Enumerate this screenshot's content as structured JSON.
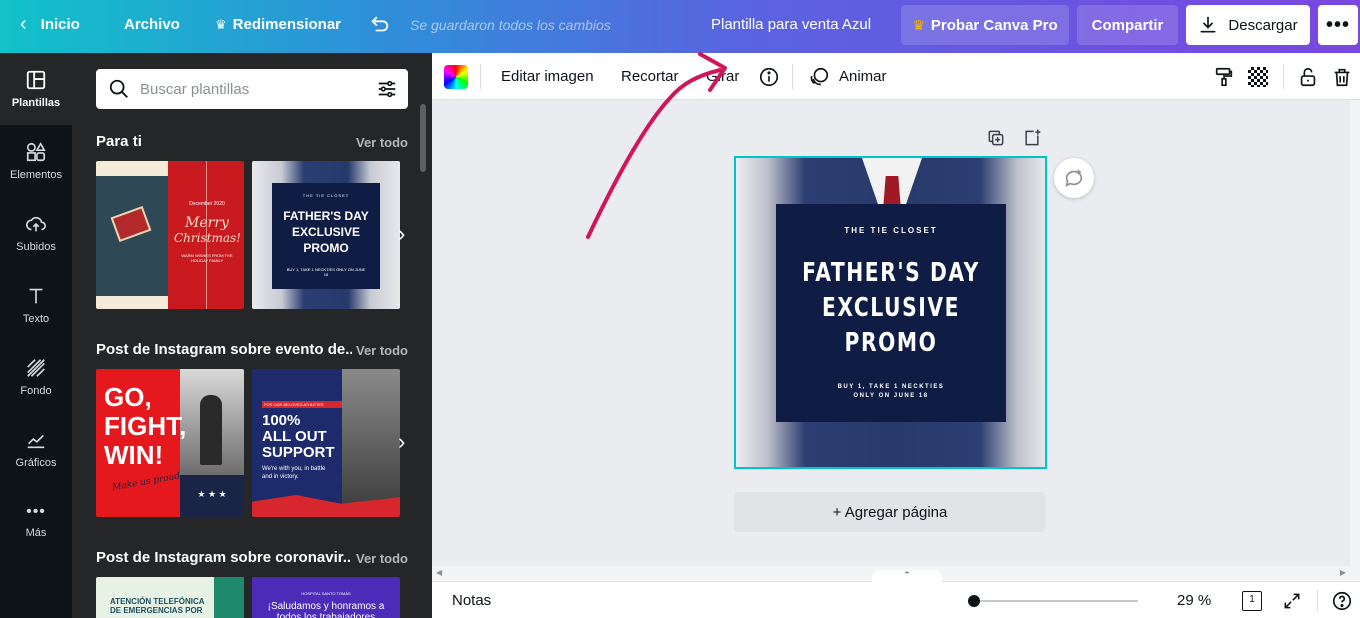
{
  "header": {
    "home_label": "Inicio",
    "file_label": "Archivo",
    "resize_label": "Redimensionar",
    "status_text": "Se guardaron todos los cambios",
    "design_title": "Plantilla para venta Azul",
    "try_pro_label": "Probar Canva Pro",
    "share_label": "Compartir",
    "download_label": "Descargar"
  },
  "rail": {
    "items": [
      {
        "label": "Plantillas"
      },
      {
        "label": "Elementos"
      },
      {
        "label": "Subidos"
      },
      {
        "label": "Texto"
      },
      {
        "label": "Fondo"
      },
      {
        "label": "Gráficos"
      },
      {
        "label": "Más"
      }
    ]
  },
  "panel": {
    "search_placeholder": "Buscar plantillas",
    "sections": [
      {
        "title": "Para ti",
        "see_all": "Ver todo"
      },
      {
        "title": "Post de Instagram sobre evento de...",
        "see_all": "Ver todo"
      },
      {
        "title": "Post de Instagram sobre coronavir...",
        "see_all": "Ver todo"
      }
    ],
    "thumbs": {
      "xmas_date": "December 2020",
      "xmas_title_1": "Merry",
      "xmas_title_2": "Christmas!",
      "xmas_sub": "WARM WISHES FROM THE HOLIDAY FAMILY",
      "fd_brand": "THE TIE CLOSET",
      "fd_title_1": "FATHER'S DAY",
      "fd_title_2": "EXCLUSIVE",
      "fd_title_3": "PROMO",
      "fd_small": "BUY 1, TAKE 1 NECKTIES ONLY ON JUNE 18",
      "go_1": "GO,",
      "go_2": "FIGHT,",
      "go_3": "WIN!",
      "go_script": "Make us proud.",
      "go_stars": "★ ★ ★",
      "support_tag": "FOR OUR BELOVED ATHLETES",
      "support_title_1": "100%",
      "support_title_2": "ALL OUT",
      "support_title_3": "SUPPORT",
      "support_sub": "We're with you, in battle and in victory.",
      "covid_1_title": "ATENCIÓN TELEFÓNICA DE EMERGENCIAS POR",
      "covid_2_small": "HOSPITAL SANTO TOMÁS",
      "covid_2_title": "¡Saludamos y honramos a todos los trabajadores"
    }
  },
  "toolbar": {
    "edit_image": "Editar imagen",
    "crop": "Recortar",
    "rotate": "Girar",
    "animate": "Animar"
  },
  "design": {
    "brand": "THE TIE CLOSET",
    "title_1": "FATHER'S DAY",
    "title_2": "EXCLUSIVE",
    "title_3": "PROMO",
    "small_1": "BUY 1, TAKE 1 NECKTIES",
    "small_2": "ONLY ON JUNE 18"
  },
  "add_page_label": "+ Agregar página",
  "footer": {
    "notes_label": "Notas",
    "zoom_text": "29 %",
    "page_count": "1",
    "zoom_fraction": 0.0
  },
  "colors": {
    "accent": "#00c4cc",
    "annotation_arrow": "#d0155a",
    "design_navy": "#0f1d45"
  }
}
